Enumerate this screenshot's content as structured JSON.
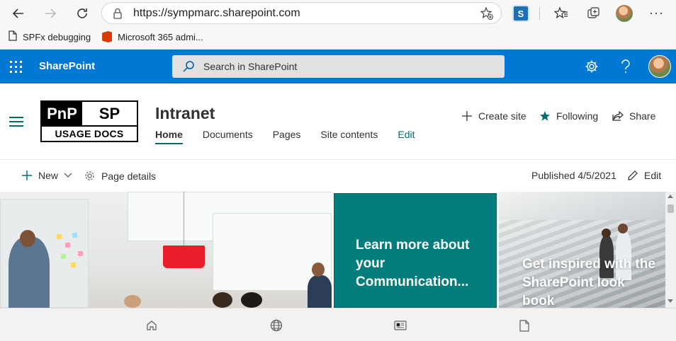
{
  "browser": {
    "url": "https://sympmarc.sharepoint.com",
    "bookmarks": [
      {
        "label": "SPFx debugging",
        "icon": "document-icon"
      },
      {
        "label": "Microsoft 365 admi...",
        "icon": "office-logo-icon"
      }
    ],
    "extension_letter": "S",
    "menu_glyph": "···"
  },
  "suitebar": {
    "brand": "SharePoint",
    "search_placeholder": "Search in SharePoint",
    "color": "#0078d4"
  },
  "site": {
    "logo_line1_left": "PnP",
    "logo_line1_right": "SP",
    "logo_line2": "USAGE DOCS",
    "title": "Intranet",
    "nav": [
      {
        "label": "Home",
        "active": true
      },
      {
        "label": "Documents",
        "active": false
      },
      {
        "label": "Pages",
        "active": false
      },
      {
        "label": "Site contents",
        "active": false
      },
      {
        "label": "Edit",
        "active": false
      }
    ],
    "actions": {
      "create_site": "Create site",
      "following": "Following",
      "share": "Share"
    },
    "theme_color": "#036c70"
  },
  "commandbar": {
    "new_label": "New",
    "page_details_label": "Page details",
    "published_label": "Published 4/5/2021",
    "edit_label": "Edit"
  },
  "hero": {
    "tile2_text": "Learn more about your Communication...",
    "tile3_text": "Get inspired with the SharePoint look book",
    "tile2_color": "#037c7c"
  }
}
